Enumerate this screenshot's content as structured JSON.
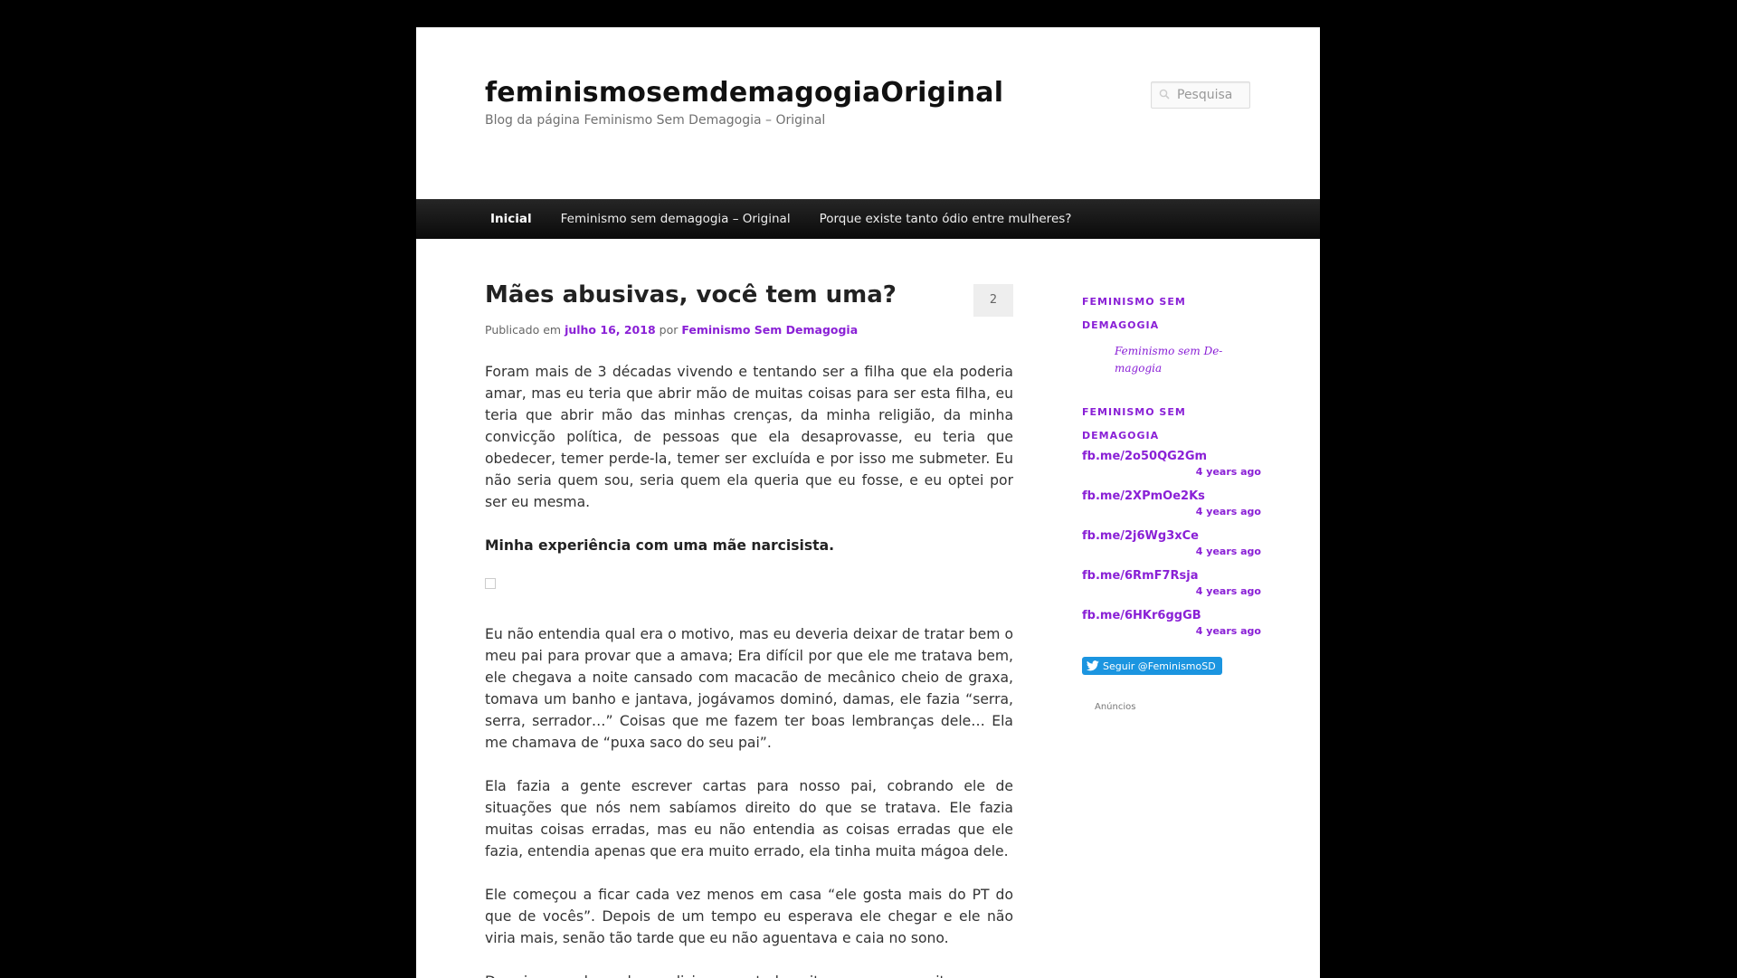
{
  "header": {
    "site_title": "feminismosemdemagogiaOriginal",
    "site_description": "Blog da página Feminismo Sem Demagogia – Original",
    "search_placeholder": "Pesquisa"
  },
  "nav": {
    "items": [
      {
        "label": "Inicial"
      },
      {
        "label": "Feminismo sem demagogia – Original"
      },
      {
        "label": "Porque existe tanto ódio entre mulheres?"
      }
    ]
  },
  "post": {
    "title": "Mães abusivas, você tem uma?",
    "comment_count": "2",
    "meta_prefix": "Publicado em",
    "date": "julho 16, 2018",
    "meta_by": "por",
    "author": "Feminismo Sem Demagogia",
    "paragraphs": [
      "Foram mais de 3 décadas vivendo e tentando ser a filha que ela poderia amar, mas eu teria que abrir mão de muitas coisas para ser esta filha, eu teria que abrir mão das minhas crenças, da minha religião, da minha convicção política, de pessoas que ela desaprovasse, eu teria que obedecer, temer perde-la, temer ser excluída e por isso me submeter. Eu não seria quem sou, seria quem ela queria que eu fosse, e eu optei por ser eu mesma.",
      "Minha experiência com uma mãe narcisista.",
      "Eu não entendia qual era o motivo, mas eu deveria deixar de tratar bem o meu pai para provar que a amava; Era difícil por que ele me tratava bem, ele chegava a noite cansado com macacão de mecânico cheio de graxa, tomava um banho e jantava, jogávamos dominó, damas, ele fazia “serra, serra, serrador…” Coisas que me fazem ter boas lembranças dele… Ela me chamava de “puxa saco do seu pai”.",
      "Ela fazia a gente escrever cartas para nosso pai, cobrando ele de situações que nós nem sabíamos direito do que se tratava. Ele fazia muitas coisas erradas, mas eu não entendia as coisas erradas que ele fazia, entendia apenas que era muito errado, ela tinha muita mágoa dele.",
      "Ele começou a ficar cada vez menos em casa “ele gosta mais do PT do que de vocês”. Depois de um tempo eu esperava ele chegar e ele não viria mais, senão tão tarde que eu não aguentava e caia no sono.",
      "Dormia com ela, e ela me dizia quase toda noite que eu era muito"
    ]
  },
  "sidebar": {
    "widget1_title": "Feminismo sem demagogia",
    "widget1_link": "Feminismo sem De-magogia",
    "widget2_title": "Feminismo sem demagogia",
    "tweets": [
      {
        "link": "fb.me/2o50QG2Gm",
        "time": "4 years ago"
      },
      {
        "link": "fb.me/2XPmOe2Ks",
        "time": "4 years ago"
      },
      {
        "link": "fb.me/2j6Wg3xCe",
        "time": "4 years ago"
      },
      {
        "link": "fb.me/6RmF7Rsja",
        "time": "4 years ago"
      },
      {
        "link": "fb.me/6HKr6ggGB",
        "time": "4 years ago"
      }
    ],
    "follow_label": "Seguir @FeminismoSD",
    "ads_label": "Anúncios"
  },
  "colors": {
    "link": "#8a20d6",
    "twitter_blue": "#1b95e0",
    "background": "#000000"
  }
}
